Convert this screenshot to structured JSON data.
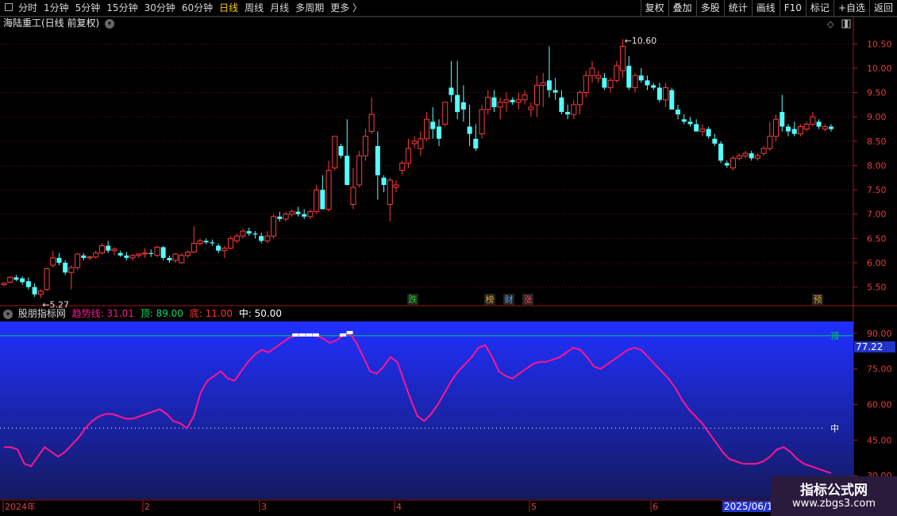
{
  "toolbar": {
    "periods": [
      "分时",
      "1分钟",
      "5分钟",
      "15分钟",
      "30分钟",
      "60分钟",
      "日线",
      "周线",
      "月线",
      "多周期",
      "更多"
    ],
    "active_period": "日线",
    "right_buttons": [
      "复权",
      "叠加",
      "多股",
      "统计",
      "画线",
      "F10",
      "标记",
      "+自选",
      "返回"
    ]
  },
  "main_panel": {
    "title": "海陆重工(日线 前复权)",
    "y_ticks": [
      "10.50",
      "10.00",
      "9.50",
      "9.00",
      "8.50",
      "8.00",
      "7.50",
      "7.00",
      "6.50",
      "6.00",
      "5.50"
    ],
    "high_label": "10.60",
    "low_label": "5.27",
    "markers": [
      {
        "text": "跌",
        "color": "#20d020"
      },
      {
        "text": "榜",
        "color": "#e0a030"
      },
      {
        "text": "财",
        "color": "#4aa0ff"
      },
      {
        "text": "涨",
        "color": "#ff4040"
      },
      {
        "text": "预",
        "color": "#e0a030"
      }
    ]
  },
  "indicator": {
    "name": "股朋指标网",
    "trend_label": "趋势线: 31.01",
    "top_label": "顶: 89.00",
    "bottom_label": "底: 11.00",
    "mid_label": "中: 50.00",
    "y_ticks": [
      "90.00",
      "75.00",
      "60.00",
      "45.00",
      "30.00"
    ],
    "current_value": "77.22",
    "top_marker": "顶",
    "mid_marker": "中",
    "colors": {
      "trend": "#ff1493",
      "top_line": "#00cc66",
      "mid_line": "#ffffff",
      "bg_top": "#2030ff",
      "bg_bottom": "#141a60"
    }
  },
  "x_axis": {
    "labels": [
      "2024年",
      "2",
      "3",
      "4",
      "5",
      "6"
    ],
    "cursor_date": "2025/06/18"
  },
  "watermark": {
    "line1": "指标公式网",
    "line2": "www.zbgs3.com"
  },
  "chart_data": [
    {
      "type": "candlestick",
      "title": "海陆重工(日线 前复权)",
      "ylim": [
        5.2,
        10.75
      ],
      "candles": [
        [
          5.55,
          5.6,
          5.52,
          5.58
        ],
        [
          5.6,
          5.72,
          5.58,
          5.7
        ],
        [
          5.7,
          5.75,
          5.62,
          5.65
        ],
        [
          5.68,
          5.72,
          5.55,
          5.6
        ],
        [
          5.62,
          5.7,
          5.45,
          5.5
        ],
        [
          5.5,
          5.58,
          5.3,
          5.35
        ],
        [
          5.35,
          5.45,
          5.27,
          5.42
        ],
        [
          5.45,
          5.9,
          5.42,
          5.88
        ],
        [
          5.95,
          6.25,
          5.9,
          6.1
        ],
        [
          6.1,
          6.2,
          5.95,
          6.0
        ],
        [
          6.0,
          6.05,
          5.75,
          5.8
        ],
        [
          5.8,
          5.95,
          5.45,
          5.9
        ],
        [
          5.9,
          6.2,
          5.85,
          6.18
        ],
        [
          6.15,
          6.2,
          6.05,
          6.1
        ],
        [
          6.1,
          6.15,
          6.05,
          6.12
        ],
        [
          6.12,
          6.25,
          6.08,
          6.2
        ],
        [
          6.2,
          6.4,
          6.18,
          6.35
        ],
        [
          6.35,
          6.45,
          6.2,
          6.25
        ],
        [
          6.25,
          6.32,
          6.15,
          6.28
        ],
        [
          6.2,
          6.25,
          6.12,
          6.15
        ],
        [
          6.15,
          6.22,
          6.05,
          6.1
        ],
        [
          6.1,
          6.18,
          6.05,
          6.15
        ],
        [
          6.15,
          6.2,
          6.1,
          6.18
        ],
        [
          6.18,
          6.3,
          6.1,
          6.2
        ],
        [
          6.2,
          6.28,
          6.12,
          6.18
        ],
        [
          6.15,
          6.35,
          6.12,
          6.32
        ],
        [
          6.32,
          6.35,
          6.05,
          6.1
        ],
        [
          6.1,
          6.15,
          6.0,
          6.05
        ],
        [
          6.05,
          6.2,
          6.0,
          6.18
        ],
        [
          6.0,
          6.2,
          5.98,
          6.15
        ],
        [
          6.15,
          6.25,
          6.1,
          6.22
        ],
        [
          6.22,
          6.75,
          6.2,
          6.4
        ],
        [
          6.4,
          6.5,
          6.35,
          6.45
        ],
        [
          6.45,
          6.5,
          6.38,
          6.42
        ],
        [
          6.42,
          6.48,
          6.35,
          6.4
        ],
        [
          6.35,
          6.4,
          6.2,
          6.25
        ],
        [
          6.25,
          6.35,
          6.1,
          6.3
        ],
        [
          6.3,
          6.55,
          6.28,
          6.5
        ],
        [
          6.45,
          6.6,
          6.4,
          6.55
        ],
        [
          6.55,
          6.7,
          6.5,
          6.65
        ],
        [
          6.65,
          6.72,
          6.55,
          6.6
        ],
        [
          6.6,
          6.65,
          6.5,
          6.58
        ],
        [
          6.55,
          6.62,
          6.4,
          6.45
        ],
        [
          6.45,
          6.65,
          6.4,
          6.55
        ],
        [
          6.55,
          7.0,
          6.5,
          6.95
        ],
        [
          6.95,
          7.05,
          6.85,
          6.9
        ],
        [
          6.9,
          7.05,
          6.85,
          7.0
        ],
        [
          7.0,
          7.1,
          6.95,
          7.05
        ],
        [
          7.05,
          7.15,
          6.95,
          7.0
        ],
        [
          7.0,
          7.1,
          6.9,
          6.95
        ],
        [
          6.95,
          7.1,
          6.9,
          7.05
        ],
        [
          7.05,
          7.6,
          7.0,
          7.5
        ],
        [
          7.5,
          7.8,
          7.4,
          7.1
        ],
        [
          7.1,
          8.1,
          7.05,
          7.9
        ],
        [
          7.95,
          8.6,
          7.9,
          8.6
        ],
        [
          8.4,
          8.45,
          8.15,
          8.2
        ],
        [
          8.2,
          8.95,
          8.1,
          7.6
        ],
        [
          7.2,
          7.95,
          7.1,
          7.55
        ],
        [
          7.6,
          8.3,
          7.55,
          8.2
        ],
        [
          8.2,
          8.75,
          8.1,
          8.6
        ],
        [
          8.7,
          9.4,
          8.65,
          9.05
        ],
        [
          8.4,
          8.7,
          7.3,
          7.8
        ],
        [
          7.75,
          7.8,
          7.45,
          7.6
        ],
        [
          7.2,
          7.75,
          6.85,
          7.7
        ],
        [
          7.55,
          7.7,
          7.45,
          7.6
        ],
        [
          7.9,
          8.1,
          7.8,
          8.05
        ],
        [
          8.05,
          8.55,
          7.95,
          8.35
        ],
        [
          8.45,
          8.6,
          8.35,
          8.5
        ],
        [
          8.35,
          8.7,
          8.2,
          8.55
        ],
        [
          8.55,
          9.1,
          8.5,
          8.95
        ],
        [
          8.9,
          9.2,
          8.55,
          8.75
        ],
        [
          8.8,
          8.95,
          8.4,
          8.55
        ],
        [
          8.85,
          9.3,
          8.8,
          9.3
        ],
        [
          9.6,
          10.15,
          9.3,
          9.45
        ],
        [
          9.45,
          10.15,
          8.95,
          9.1
        ],
        [
          9.3,
          9.65,
          8.9,
          9.15
        ],
        [
          8.8,
          9.25,
          8.4,
          8.65
        ],
        [
          8.55,
          8.85,
          8.3,
          8.35
        ],
        [
          8.65,
          9.25,
          8.55,
          9.15
        ],
        [
          9.15,
          9.55,
          9.05,
          9.4
        ],
        [
          9.4,
          9.55,
          9.1,
          9.2
        ],
        [
          9.2,
          9.4,
          8.95,
          9.3
        ],
        [
          9.3,
          9.5,
          9.1,
          9.35
        ],
        [
          9.35,
          9.4,
          9.25,
          9.3
        ],
        [
          9.3,
          9.5,
          9.15,
          9.35
        ],
        [
          9.35,
          9.55,
          9.25,
          9.45
        ],
        [
          9.15,
          9.3,
          9.0,
          9.2
        ],
        [
          9.25,
          9.85,
          9.0,
          9.65
        ],
        [
          9.65,
          9.9,
          9.2,
          9.7
        ],
        [
          9.75,
          10.45,
          9.4,
          9.55
        ],
        [
          9.55,
          9.8,
          9.35,
          9.5
        ],
        [
          9.4,
          9.55,
          9.05,
          9.1
        ],
        [
          9.1,
          9.25,
          8.95,
          9.05
        ],
        [
          9.05,
          9.35,
          8.95,
          9.25
        ],
        [
          9.25,
          9.55,
          9.05,
          9.5
        ],
        [
          9.5,
          9.95,
          9.4,
          9.85
        ],
        [
          9.85,
          10.15,
          9.7,
          10.0
        ],
        [
          9.8,
          9.95,
          9.7,
          9.85
        ],
        [
          9.8,
          9.9,
          9.55,
          9.6
        ],
        [
          9.6,
          9.8,
          9.5,
          9.75
        ],
        [
          9.75,
          10.15,
          9.7,
          10.05
        ],
        [
          9.95,
          10.6,
          9.8,
          10.45
        ],
        [
          10.05,
          10.25,
          9.55,
          9.6
        ],
        [
          9.6,
          9.9,
          9.5,
          9.85
        ],
        [
          9.85,
          10.0,
          9.7,
          9.75
        ],
        [
          9.75,
          9.85,
          9.55,
          9.65
        ],
        [
          9.65,
          9.7,
          9.55,
          9.6
        ],
        [
          9.6,
          9.7,
          9.3,
          9.35
        ],
        [
          9.35,
          9.7,
          9.2,
          9.6
        ],
        [
          9.55,
          9.6,
          9.15,
          9.15
        ],
        [
          9.15,
          9.25,
          8.95,
          9.05
        ],
        [
          8.95,
          9.05,
          8.85,
          8.9
        ],
        [
          8.9,
          9.0,
          8.8,
          8.85
        ],
        [
          8.85,
          8.95,
          8.7,
          8.7
        ],
        [
          8.7,
          8.85,
          8.6,
          8.75
        ],
        [
          8.75,
          8.8,
          8.55,
          8.6
        ],
        [
          8.55,
          8.65,
          8.4,
          8.45
        ],
        [
          8.45,
          8.5,
          8.05,
          8.1
        ],
        [
          8.05,
          8.1,
          7.95,
          8.0
        ],
        [
          7.95,
          8.2,
          7.9,
          8.15
        ],
        [
          8.15,
          8.25,
          8.1,
          8.2
        ],
        [
          8.2,
          8.3,
          8.15,
          8.25
        ],
        [
          8.25,
          8.3,
          8.1,
          8.15
        ],
        [
          8.15,
          8.25,
          8.1,
          8.2
        ],
        [
          8.25,
          8.4,
          8.2,
          8.35
        ],
        [
          8.35,
          8.9,
          8.3,
          8.6
        ],
        [
          8.6,
          9.05,
          8.5,
          8.95
        ],
        [
          9.1,
          9.45,
          8.7,
          8.8
        ],
        [
          8.8,
          8.85,
          8.6,
          8.7
        ],
        [
          8.75,
          8.9,
          8.6,
          8.65
        ],
        [
          8.65,
          8.85,
          8.6,
          8.8
        ],
        [
          8.75,
          8.9,
          8.7,
          8.85
        ],
        [
          8.85,
          9.1,
          8.8,
          9.0
        ],
        [
          8.9,
          8.95,
          8.75,
          8.8
        ],
        [
          8.75,
          8.85,
          8.7,
          8.8
        ],
        [
          8.8,
          8.85,
          8.7,
          8.75
        ]
      ]
    },
    {
      "type": "line",
      "title": "股朋指标网",
      "ylim": [
        20,
        95
      ],
      "series": [
        {
          "name": "趋势线",
          "values": [
            42,
            42,
            41,
            35,
            34,
            38,
            42,
            40,
            38,
            40,
            43,
            46,
            50,
            53,
            55,
            56,
            56,
            55,
            54,
            54,
            55,
            56,
            57,
            58,
            56,
            53,
            52,
            50,
            55,
            65,
            70,
            72,
            74,
            71,
            70,
            74,
            78,
            81,
            83,
            82,
            84,
            86,
            88,
            89,
            89,
            89,
            89,
            88,
            86,
            87,
            89,
            90,
            86,
            80,
            74,
            73,
            76,
            80,
            78,
            70,
            62,
            55,
            53,
            56,
            60,
            65,
            70,
            74,
            77,
            80,
            84,
            85,
            80,
            74,
            72,
            71,
            73,
            75,
            77,
            78,
            78,
            79,
            80,
            82,
            84,
            83,
            80,
            76,
            75,
            77,
            79,
            81,
            83,
            84,
            83,
            80,
            77,
            74,
            71,
            67,
            62,
            58,
            55,
            52,
            48,
            44,
            40,
            37,
            36,
            35,
            35,
            35,
            36,
            38,
            41,
            42,
            40,
            37,
            35,
            34,
            33,
            32,
            31
          ]
        }
      ],
      "reference_lines": {
        "top": 89.0,
        "mid": 50.0,
        "bottom": 11.0
      }
    }
  ]
}
